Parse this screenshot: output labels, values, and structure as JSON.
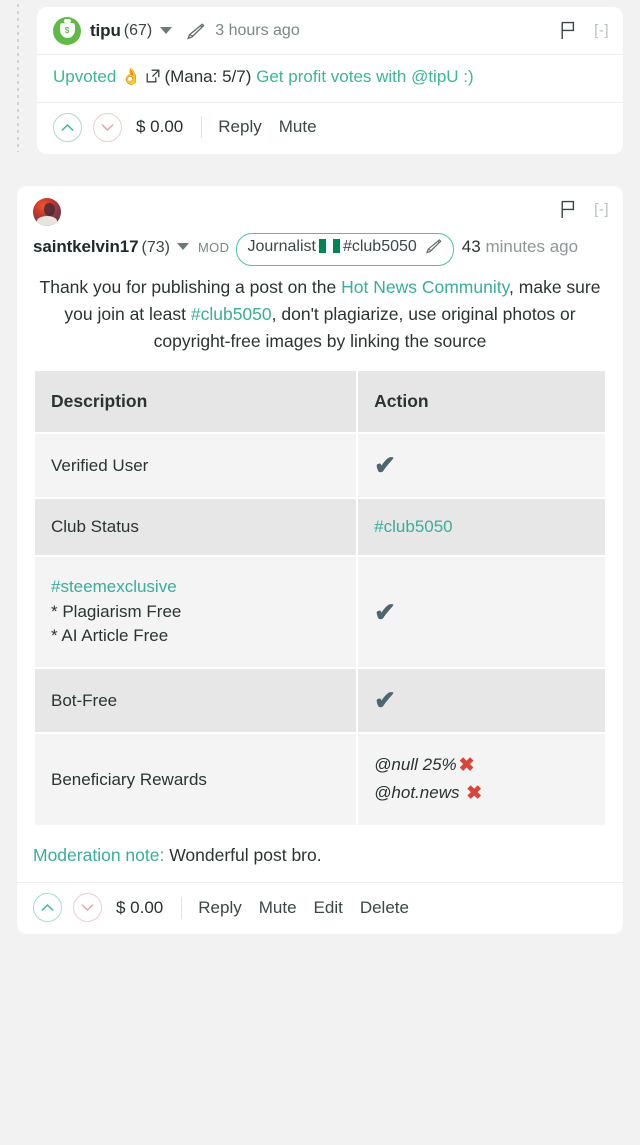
{
  "theme": {
    "page_bg": "#f2f2f2",
    "card_bg": "#ffffff",
    "link_teal": "#3aae9a",
    "tick_color": "#4c6670",
    "x_color": "#d9453a",
    "upvote_border": "#a9ddcf",
    "downvote_border": "#eecfcf",
    "pill_border": "#4cc2a6",
    "table_header_bg": "#e6e6e6",
    "table_row_light": "#f4f4f4",
    "table_row_dark": "#e7e7e7"
  },
  "comments": [
    {
      "id": "tipu-comment",
      "author": "tipu",
      "reputation": "(67)",
      "avatar_icon": "money-bag-avatar",
      "edited_icon": "pencil-icon",
      "timestamp": "3 hours ago",
      "flag_icon": "flag-icon",
      "collapse_label": "[-]",
      "body": {
        "upvoted_label": "Upvoted",
        "ok_emoji": "ok-hand-emoji",
        "external_icon": "external-link-icon",
        "mana_text": "(Mana: 5/7)",
        "promo_text": "Get profit votes with @tipU :)"
      },
      "footer": {
        "upvote_icon": "chevron-up-icon",
        "downvote_icon": "chevron-down-icon",
        "payout": "$ 0.00",
        "actions": [
          "Reply",
          "Mute"
        ]
      }
    },
    {
      "id": "saintkelvin17-comment",
      "author": "saintkelvin17",
      "reputation": "(73)",
      "avatar_icon": "user-photo-avatar",
      "role_tag": "MOD",
      "badge": {
        "label": "Journalist",
        "flag_icon": "nigeria-flag-icon",
        "club_tag": "#club5050",
        "pencil_icon": "pencil-icon"
      },
      "timestamp_number": "43",
      "timestamp_rest": "minutes ago",
      "flag_icon": "flag-icon",
      "collapse_label": "[-]",
      "body": {
        "intro_part1": "Thank you for publishing a post on the ",
        "community_link": "Hot News Community",
        "intro_part2": ", make sure you join at least ",
        "club_link": "#club5050",
        "intro_part3": ", don't plagiarize, use original photos or copyright-free images by linking the source"
      },
      "table": {
        "headers": [
          "Description",
          "Action"
        ],
        "rows": [
          {
            "description_lines": [
              "Verified User"
            ],
            "description_link_first": false,
            "action_type": "tick",
            "action_text": "✔"
          },
          {
            "description_lines": [
              "Club Status"
            ],
            "description_link_first": false,
            "action_type": "link",
            "action_text": "#club5050"
          },
          {
            "description_lines": [
              "#steemexclusive",
              "* Plagiarism Free",
              "* AI Article Free"
            ],
            "description_link_first": true,
            "action_type": "tick",
            "action_text": "✔"
          },
          {
            "description_lines": [
              "Bot-Free"
            ],
            "description_link_first": false,
            "action_type": "tick",
            "action_text": "✔"
          },
          {
            "description_lines": [
              "Beneficiary Rewards"
            ],
            "description_link_first": false,
            "action_type": "beneficiary",
            "beneficiaries": [
              {
                "account": "@null 25%",
                "mark": "✖"
              },
              {
                "account": "@hot.news ",
                "mark": "✖"
              }
            ]
          }
        ]
      },
      "moderation_note": {
        "label": "Moderation note:",
        "text": " Wonderful post bro."
      },
      "footer": {
        "upvote_icon": "chevron-up-icon",
        "downvote_icon": "chevron-down-icon",
        "payout": "$ 0.00",
        "actions": [
          "Reply",
          "Mute",
          "Edit",
          "Delete"
        ]
      }
    }
  ]
}
